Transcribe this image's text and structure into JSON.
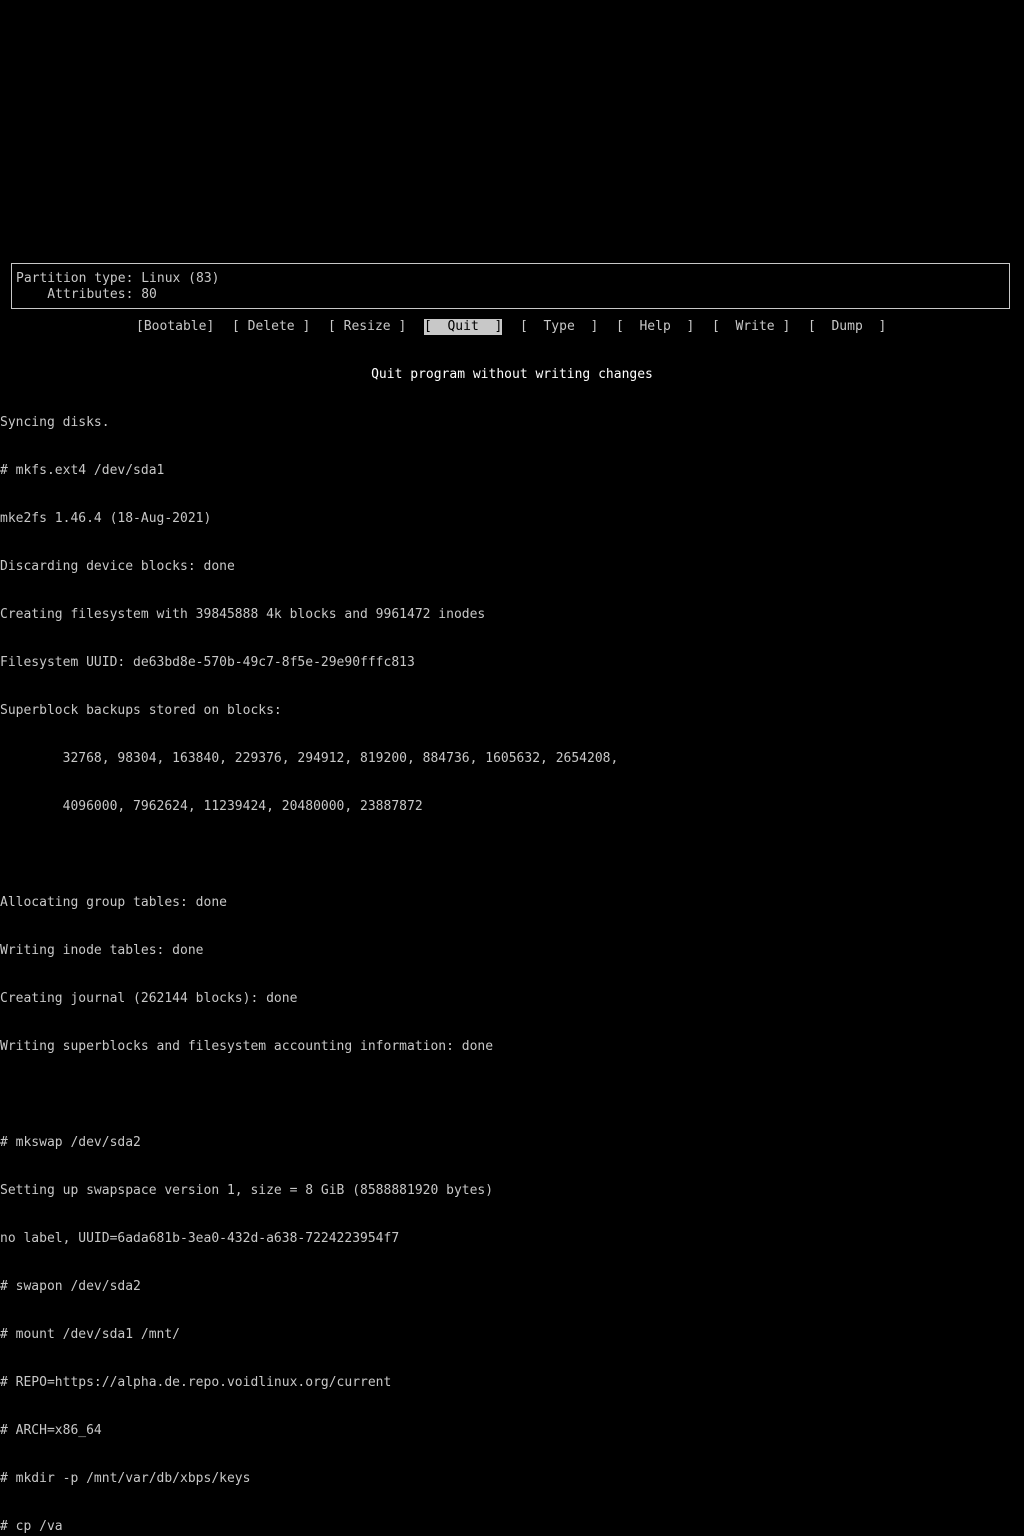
{
  "info": {
    "partition_type": "Partition type: Linux (83)",
    "attributes": "    Attributes: 80"
  },
  "menu": {
    "items": [
      {
        "label": "[Bootable]",
        "selected": false
      },
      {
        "label": "[ Delete ]",
        "selected": false
      },
      {
        "label": "[ Resize ]",
        "selected": false
      },
      {
        "label": "[  Quit  ]",
        "selected": true
      },
      {
        "label": "[  Type  ]",
        "selected": false
      },
      {
        "label": "[  Help  ]",
        "selected": false
      },
      {
        "label": "[  Write ]",
        "selected": false
      },
      {
        "label": "[  Dump  ]",
        "selected": false
      }
    ]
  },
  "hint": "Quit program without writing changes",
  "terminal": {
    "lines": [
      "Syncing disks.",
      "# mkfs.ext4 /dev/sda1",
      "mke2fs 1.46.4 (18-Aug-2021)",
      "Discarding device blocks: done",
      "Creating filesystem with 39845888 4k blocks and 9961472 inodes",
      "Filesystem UUID: de63bd8e-570b-49c7-8f5e-29e90fffc813",
      "Superblock backups stored on blocks:",
      "        32768, 98304, 163840, 229376, 294912, 819200, 884736, 1605632, 2654208,",
      "        4096000, 7962624, 11239424, 20480000, 23887872",
      "",
      "Allocating group tables: done",
      "Writing inode tables: done",
      "Creating journal (262144 blocks): done",
      "Writing superblocks and filesystem accounting information: done",
      "",
      "# mkswap /dev/sda2",
      "Setting up swapspace version 1, size = 8 GiB (8588881920 bytes)",
      "no label, UUID=6ada681b-3ea0-432d-a638-7224223954f7",
      "# swapon /dev/sda2",
      "# mount /dev/sda1 /mnt/",
      "# REPO=https://alpha.de.repo.voidlinux.org/current",
      "# ARCH=x86_64",
      "# mkdir -p /mnt/var/db/xbps/keys",
      "# cp /va"
    ]
  }
}
